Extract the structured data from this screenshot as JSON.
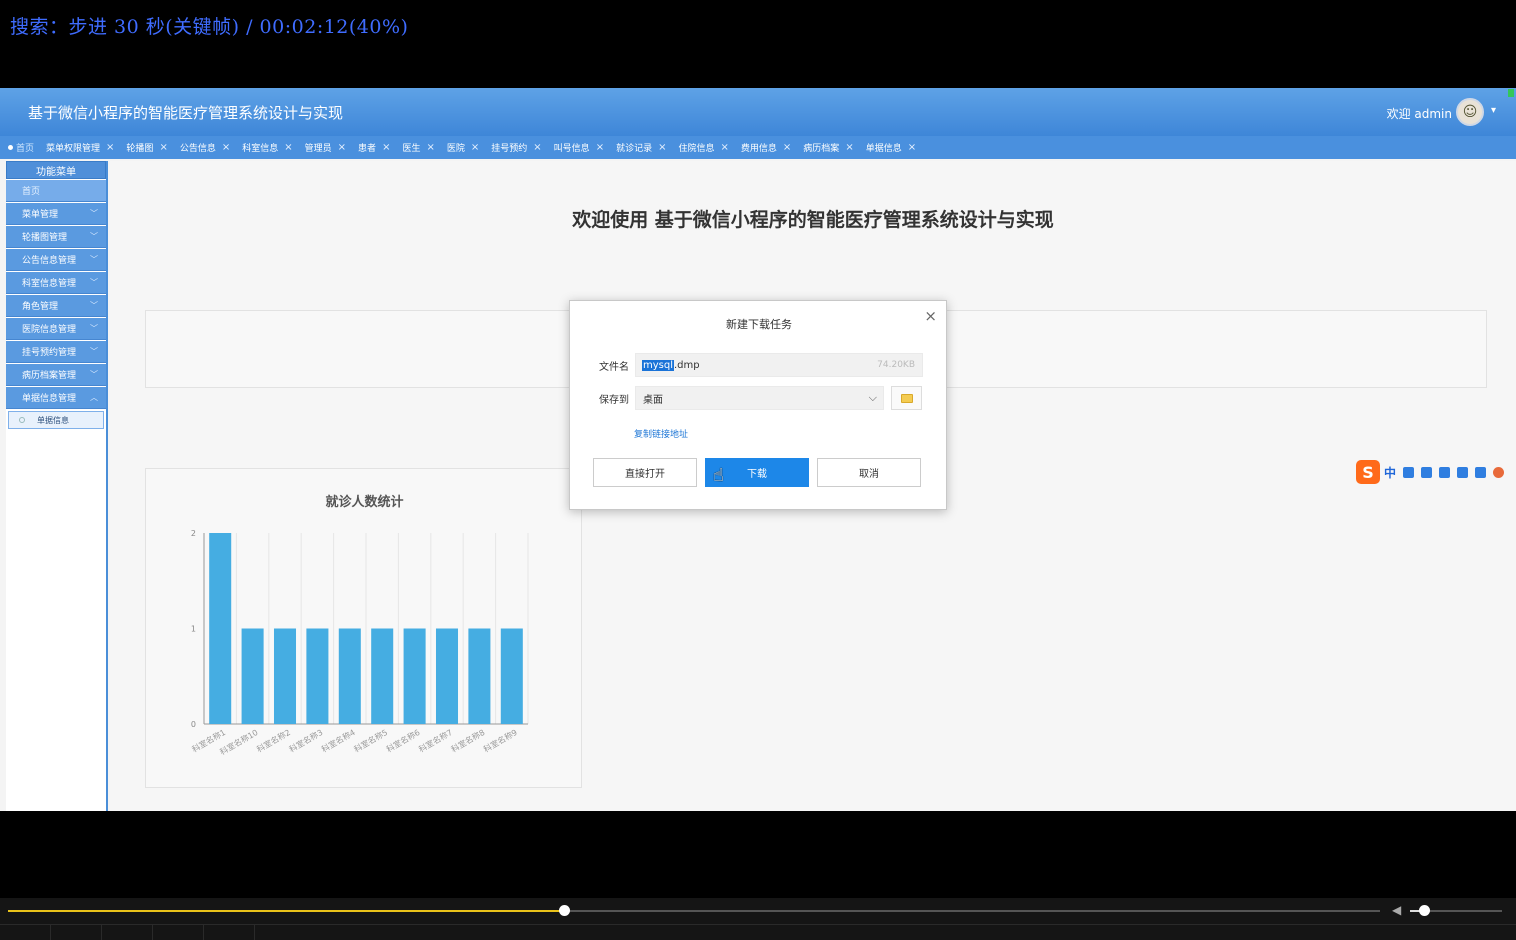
{
  "osd": {
    "text": "搜索：步进 30 秒(关键帧) / 00:02:12(40%)"
  },
  "header": {
    "title": "基于微信小程序的智能医疗管理系统设计与实现",
    "welcome": "欢迎 admin"
  },
  "tabs": [
    {
      "label": "首页",
      "closable": false,
      "active": true
    },
    {
      "label": "菜单权限管理",
      "closable": true
    },
    {
      "label": "轮播图",
      "closable": true
    },
    {
      "label": "公告信息",
      "closable": true
    },
    {
      "label": "科室信息",
      "closable": true
    },
    {
      "label": "管理员",
      "closable": true
    },
    {
      "label": "患者",
      "closable": true
    },
    {
      "label": "医生",
      "closable": true
    },
    {
      "label": "医院",
      "closable": true
    },
    {
      "label": "挂号预约",
      "closable": true
    },
    {
      "label": "叫号信息",
      "closable": true
    },
    {
      "label": "就诊记录",
      "closable": true
    },
    {
      "label": "住院信息",
      "closable": true
    },
    {
      "label": "费用信息",
      "closable": true
    },
    {
      "label": "病历档案",
      "closable": true
    },
    {
      "label": "单据信息",
      "closable": true
    }
  ],
  "sidebar": {
    "heading": "功能菜单",
    "items": [
      {
        "label": "首页"
      },
      {
        "label": "菜单管理"
      },
      {
        "label": "轮播图管理"
      },
      {
        "label": "公告信息管理"
      },
      {
        "label": "科室信息管理"
      },
      {
        "label": "角色管理"
      },
      {
        "label": "医院信息管理"
      },
      {
        "label": "挂号预约管理"
      },
      {
        "label": "病历档案管理"
      },
      {
        "label": "单据信息管理"
      }
    ],
    "subitem": "单据信息"
  },
  "main": {
    "welcome": "欢迎使用 基于微信小程序的智能医疗管理系统设计与实现"
  },
  "chart_data": {
    "type": "bar",
    "title": "就诊人数统计",
    "categories": [
      "科室名称1",
      "科室名称10",
      "科室名称2",
      "科室名称3",
      "科室名称4",
      "科室名称5",
      "科室名称6",
      "科室名称7",
      "科室名称8",
      "科室名称9"
    ],
    "values": [
      2,
      1,
      1,
      1,
      1,
      1,
      1,
      1,
      1,
      1
    ],
    "ylim": [
      0,
      2
    ],
    "yticks": [
      "0",
      "1",
      "2"
    ],
    "bar_color": "#45ade2",
    "grid": true
  },
  "dialog": {
    "title": "新建下载任务",
    "filename_label": "文件名",
    "filename_selected": "mysql",
    "filename_rest": ".dmp",
    "filesize": "74.20KB",
    "saveto_label": "保存到",
    "saveto_value": "桌面",
    "copy_link": "复制链接地址",
    "btn_open": "直接打开",
    "btn_download": "下载",
    "btn_cancel": "取消"
  },
  "ime": {
    "logo": "S",
    "mode": "中"
  },
  "player": {
    "progress": 0.4,
    "volume": 0.15
  },
  "colors": {
    "accent": "#4a90de",
    "primary_button": "#1d87e8",
    "seek": "#e9c21a"
  }
}
